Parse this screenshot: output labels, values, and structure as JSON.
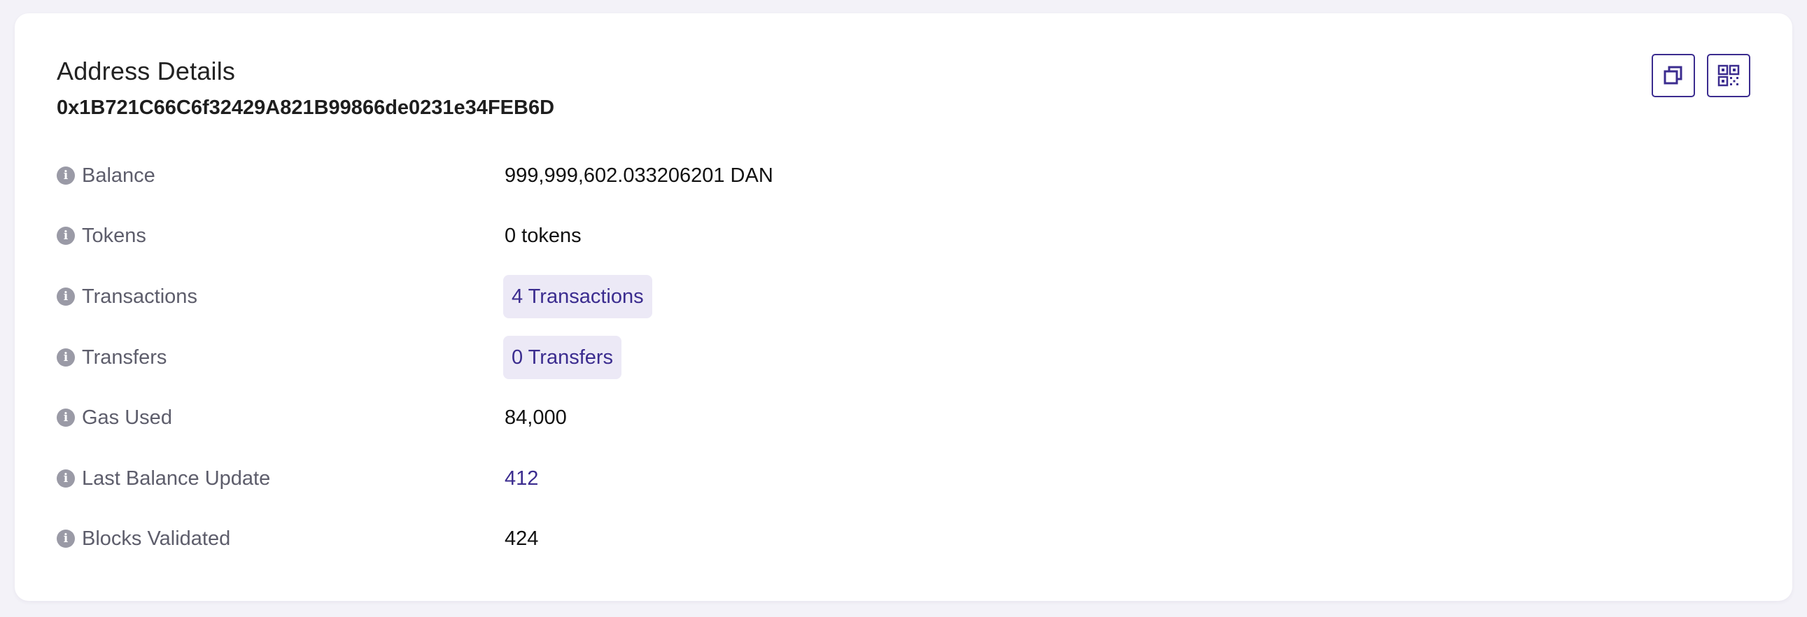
{
  "header": {
    "title": "Address Details",
    "address": "0x1B721C66C6f32429A821B99866de0231e34FEB6D"
  },
  "actions": {
    "copy_icon": "copy-icon",
    "qr_icon": "qr-code-icon"
  },
  "details": [
    {
      "label": "Balance",
      "value": "999,999,602.033206201 DAN",
      "style": "text"
    },
    {
      "label": "Tokens",
      "value": "0 tokens",
      "style": "text"
    },
    {
      "label": "Transactions",
      "value": "4 Transactions",
      "style": "pill"
    },
    {
      "label": "Transfers",
      "value": "0 Transfers",
      "style": "pill"
    },
    {
      "label": "Gas Used",
      "value": "84,000",
      "style": "text"
    },
    {
      "label": "Last Balance Update",
      "value": "412",
      "style": "link"
    },
    {
      "label": "Blocks Validated",
      "value": "424",
      "style": "text"
    }
  ],
  "colors": {
    "accent": "#3b2c8f",
    "pill_bg": "#ece9f6",
    "label": "#5d5d6b",
    "info_icon": "#9a9aa6",
    "page_bg": "#f3f2f8"
  }
}
